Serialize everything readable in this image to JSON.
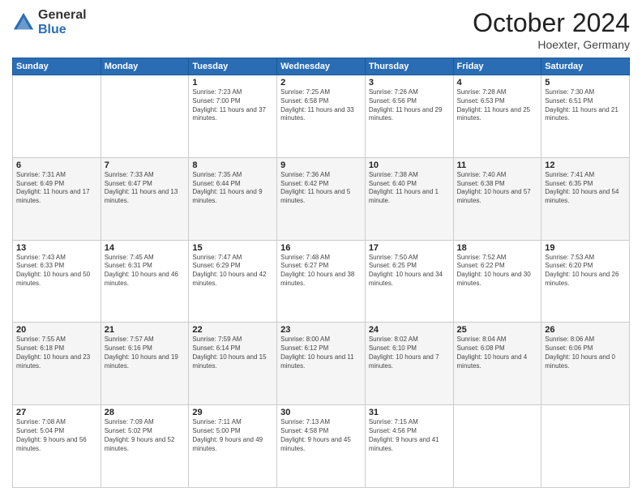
{
  "logo": {
    "general": "General",
    "blue": "Blue"
  },
  "title": "October 2024",
  "location": "Hoexter, Germany",
  "days_header": [
    "Sunday",
    "Monday",
    "Tuesday",
    "Wednesday",
    "Thursday",
    "Friday",
    "Saturday"
  ],
  "weeks": [
    [
      {
        "num": "",
        "info": ""
      },
      {
        "num": "",
        "info": ""
      },
      {
        "num": "1",
        "info": "Sunrise: 7:23 AM\nSunset: 7:00 PM\nDaylight: 11 hours and 37 minutes."
      },
      {
        "num": "2",
        "info": "Sunrise: 7:25 AM\nSunset: 6:58 PM\nDaylight: 11 hours and 33 minutes."
      },
      {
        "num": "3",
        "info": "Sunrise: 7:26 AM\nSunset: 6:56 PM\nDaylight: 11 hours and 29 minutes."
      },
      {
        "num": "4",
        "info": "Sunrise: 7:28 AM\nSunset: 6:53 PM\nDaylight: 11 hours and 25 minutes."
      },
      {
        "num": "5",
        "info": "Sunrise: 7:30 AM\nSunset: 6:51 PM\nDaylight: 11 hours and 21 minutes."
      }
    ],
    [
      {
        "num": "6",
        "info": "Sunrise: 7:31 AM\nSunset: 6:49 PM\nDaylight: 11 hours and 17 minutes."
      },
      {
        "num": "7",
        "info": "Sunrise: 7:33 AM\nSunset: 6:47 PM\nDaylight: 11 hours and 13 minutes."
      },
      {
        "num": "8",
        "info": "Sunrise: 7:35 AM\nSunset: 6:44 PM\nDaylight: 11 hours and 9 minutes."
      },
      {
        "num": "9",
        "info": "Sunrise: 7:36 AM\nSunset: 6:42 PM\nDaylight: 11 hours and 5 minutes."
      },
      {
        "num": "10",
        "info": "Sunrise: 7:38 AM\nSunset: 6:40 PM\nDaylight: 11 hours and 1 minute."
      },
      {
        "num": "11",
        "info": "Sunrise: 7:40 AM\nSunset: 6:38 PM\nDaylight: 10 hours and 57 minutes."
      },
      {
        "num": "12",
        "info": "Sunrise: 7:41 AM\nSunset: 6:35 PM\nDaylight: 10 hours and 54 minutes."
      }
    ],
    [
      {
        "num": "13",
        "info": "Sunrise: 7:43 AM\nSunset: 6:33 PM\nDaylight: 10 hours and 50 minutes."
      },
      {
        "num": "14",
        "info": "Sunrise: 7:45 AM\nSunset: 6:31 PM\nDaylight: 10 hours and 46 minutes."
      },
      {
        "num": "15",
        "info": "Sunrise: 7:47 AM\nSunset: 6:29 PM\nDaylight: 10 hours and 42 minutes."
      },
      {
        "num": "16",
        "info": "Sunrise: 7:48 AM\nSunset: 6:27 PM\nDaylight: 10 hours and 38 minutes."
      },
      {
        "num": "17",
        "info": "Sunrise: 7:50 AM\nSunset: 6:25 PM\nDaylight: 10 hours and 34 minutes."
      },
      {
        "num": "18",
        "info": "Sunrise: 7:52 AM\nSunset: 6:22 PM\nDaylight: 10 hours and 30 minutes."
      },
      {
        "num": "19",
        "info": "Sunrise: 7:53 AM\nSunset: 6:20 PM\nDaylight: 10 hours and 26 minutes."
      }
    ],
    [
      {
        "num": "20",
        "info": "Sunrise: 7:55 AM\nSunset: 6:18 PM\nDaylight: 10 hours and 23 minutes."
      },
      {
        "num": "21",
        "info": "Sunrise: 7:57 AM\nSunset: 6:16 PM\nDaylight: 10 hours and 19 minutes."
      },
      {
        "num": "22",
        "info": "Sunrise: 7:59 AM\nSunset: 6:14 PM\nDaylight: 10 hours and 15 minutes."
      },
      {
        "num": "23",
        "info": "Sunrise: 8:00 AM\nSunset: 6:12 PM\nDaylight: 10 hours and 11 minutes."
      },
      {
        "num": "24",
        "info": "Sunrise: 8:02 AM\nSunset: 6:10 PM\nDaylight: 10 hours and 7 minutes."
      },
      {
        "num": "25",
        "info": "Sunrise: 8:04 AM\nSunset: 6:08 PM\nDaylight: 10 hours and 4 minutes."
      },
      {
        "num": "26",
        "info": "Sunrise: 8:06 AM\nSunset: 6:06 PM\nDaylight: 10 hours and 0 minutes."
      }
    ],
    [
      {
        "num": "27",
        "info": "Sunrise: 7:08 AM\nSunset: 5:04 PM\nDaylight: 9 hours and 56 minutes."
      },
      {
        "num": "28",
        "info": "Sunrise: 7:09 AM\nSunset: 5:02 PM\nDaylight: 9 hours and 52 minutes."
      },
      {
        "num": "29",
        "info": "Sunrise: 7:11 AM\nSunset: 5:00 PM\nDaylight: 9 hours and 49 minutes."
      },
      {
        "num": "30",
        "info": "Sunrise: 7:13 AM\nSunset: 4:58 PM\nDaylight: 9 hours and 45 minutes."
      },
      {
        "num": "31",
        "info": "Sunrise: 7:15 AM\nSunset: 4:56 PM\nDaylight: 9 hours and 41 minutes."
      },
      {
        "num": "",
        "info": ""
      },
      {
        "num": "",
        "info": ""
      }
    ]
  ]
}
